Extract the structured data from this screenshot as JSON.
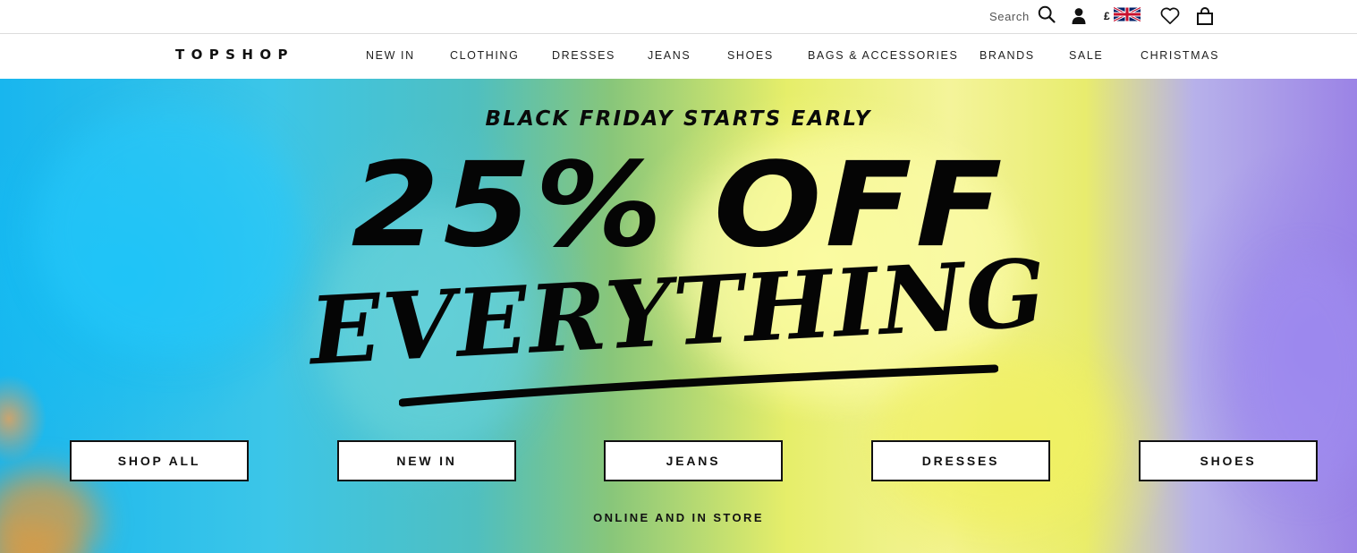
{
  "utility": {
    "search_label": "Search",
    "currency_symbol": "£",
    "icons": [
      "search-icon",
      "account-icon",
      "uk-flag-icon",
      "wishlist-heart-icon",
      "shopping-bag-icon"
    ]
  },
  "brand": {
    "logo": "TOPSHOP"
  },
  "nav": {
    "items": [
      {
        "label": "NEW IN"
      },
      {
        "label": "CLOTHING"
      },
      {
        "label": "DRESSES"
      },
      {
        "label": "JEANS"
      },
      {
        "label": "SHOES"
      },
      {
        "label": "BAGS & ACCESSORIES"
      },
      {
        "label": "BRANDS"
      },
      {
        "label": "SALE"
      },
      {
        "label": "CHRISTMAS"
      }
    ]
  },
  "hero": {
    "kicker": "BLACK FRIDAY STARTS EARLY",
    "headline": "25% OFF",
    "script_word": "EVERYTHING",
    "ctas": [
      {
        "label": "SHOP ALL"
      },
      {
        "label": "NEW IN"
      },
      {
        "label": "JEANS"
      },
      {
        "label": "DRESSES"
      },
      {
        "label": "SHOES"
      }
    ],
    "subline": "ONLINE AND IN STORE"
  },
  "colors": {
    "text": "#111111",
    "border": "#dcdcdc",
    "smoke_blue": "#18b6ee",
    "smoke_teal": "#4fbfc0",
    "smoke_yellow": "#f4f49a",
    "smoke_purple": "#9b83e6",
    "smoke_orange": "#fa9628"
  }
}
